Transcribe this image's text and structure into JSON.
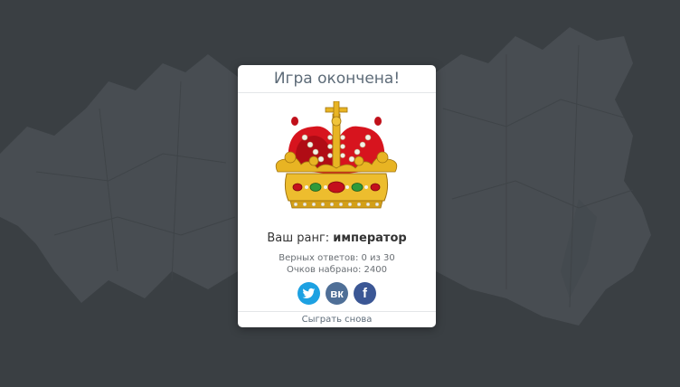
{
  "modal": {
    "title": "Игра окончена!",
    "rank_label": "Ваш ранг:",
    "rank_value": "император",
    "correct_line": "Верных ответов: 0 из 30",
    "score_line": "Очков набрано: 2400",
    "replay_label": "Сыграть снова"
  },
  "social": {
    "twitter_icon": "twitter-icon",
    "vk_icon": "vk-icon",
    "vk_glyph": "вк",
    "facebook_icon": "facebook-icon",
    "facebook_glyph": "f"
  },
  "colors": {
    "background": "#3a3f43",
    "map_fill": "#4a4f54",
    "twitter": "#1da1e2",
    "vk": "#4f6f97",
    "facebook": "#3b5795"
  }
}
